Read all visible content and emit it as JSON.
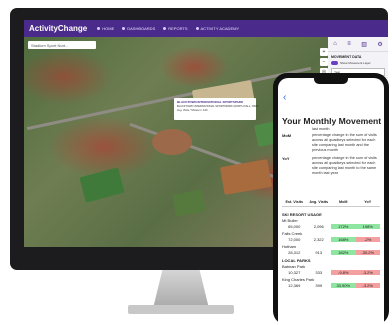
{
  "app": {
    "logo": "ActivityChange",
    "nav": [
      "HOME",
      "DASHBOARDS",
      "REPORTS",
      "ACTIVITY ACADEMY"
    ]
  },
  "map": {
    "search_placeholder": "Stadium Sport Nort...",
    "tooltip_title": "BLACKTOWN INTERNATIONAL SPORTSPARK",
    "tooltip_lines": [
      "BLACKTOWN INTERNATIONAL SPORTSPARK (NORTH FALL, NSW)",
      "Avg. Visits / Shows in: 100"
    ]
  },
  "panel": {
    "icons": [
      "home-icon",
      "layers-icon",
      "chart-icon",
      "gear-icon"
    ],
    "section_title": "MOVEMENT DATA",
    "toggle_label": "Show Movement Layer",
    "select_1": "Year",
    "select_2": "Apr-Jun 2023",
    "link_1": "Apply Filter",
    "link_2": "Rank Visits"
  },
  "report": {
    "title": "Your Monthly Movement Report",
    "top_cut": "last month",
    "definitions": [
      {
        "key": "MoM",
        "text": "percentage change in the sum of visits across all quadkeys selected for each site comparing last month and the previous month"
      },
      {
        "key": "YoY",
        "text": "percentage change in the sum of visits across all quadkeys selected for each site comparing last month to the same month last year"
      }
    ],
    "columns": [
      "Est. Visits",
      "Avg. Visits",
      "MoM",
      "YoY"
    ],
    "groups": [
      {
        "name": "SKI RESORT USAGE",
        "rows": [
          {
            "name": "Mt Buller",
            "est": "65,000",
            "avg": "2,096",
            "mom": "172%",
            "mom_pos": true,
            "yoy": "198%",
            "yoy_pos": true
          },
          {
            "name": "Falls Creek",
            "est": "72,000",
            "avg": "2,322",
            "mom": "168%",
            "mom_pos": true,
            "yoy": "-2%",
            "yoy_pos": false
          },
          {
            "name": "Hotham",
            "est": "28,312",
            "avg": "913",
            "mom": "182%",
            "mom_pos": true,
            "yoy": "-30.2%",
            "yoy_pos": false
          }
        ]
      },
      {
        "name": "LOCAL PARKS",
        "rows": [
          {
            "name": "Batman Park",
            "est": "10,327",
            "avg": "333",
            "mom": "-9.8%",
            "mom_pos": false,
            "yoy": "-3.2%",
            "yoy_pos": false
          },
          {
            "name": "King Charles Park",
            "est": "12,369",
            "avg": "399",
            "mom": "33.90%",
            "mom_pos": true,
            "yoy": "-3.2%",
            "yoy_pos": false
          }
        ]
      }
    ]
  }
}
